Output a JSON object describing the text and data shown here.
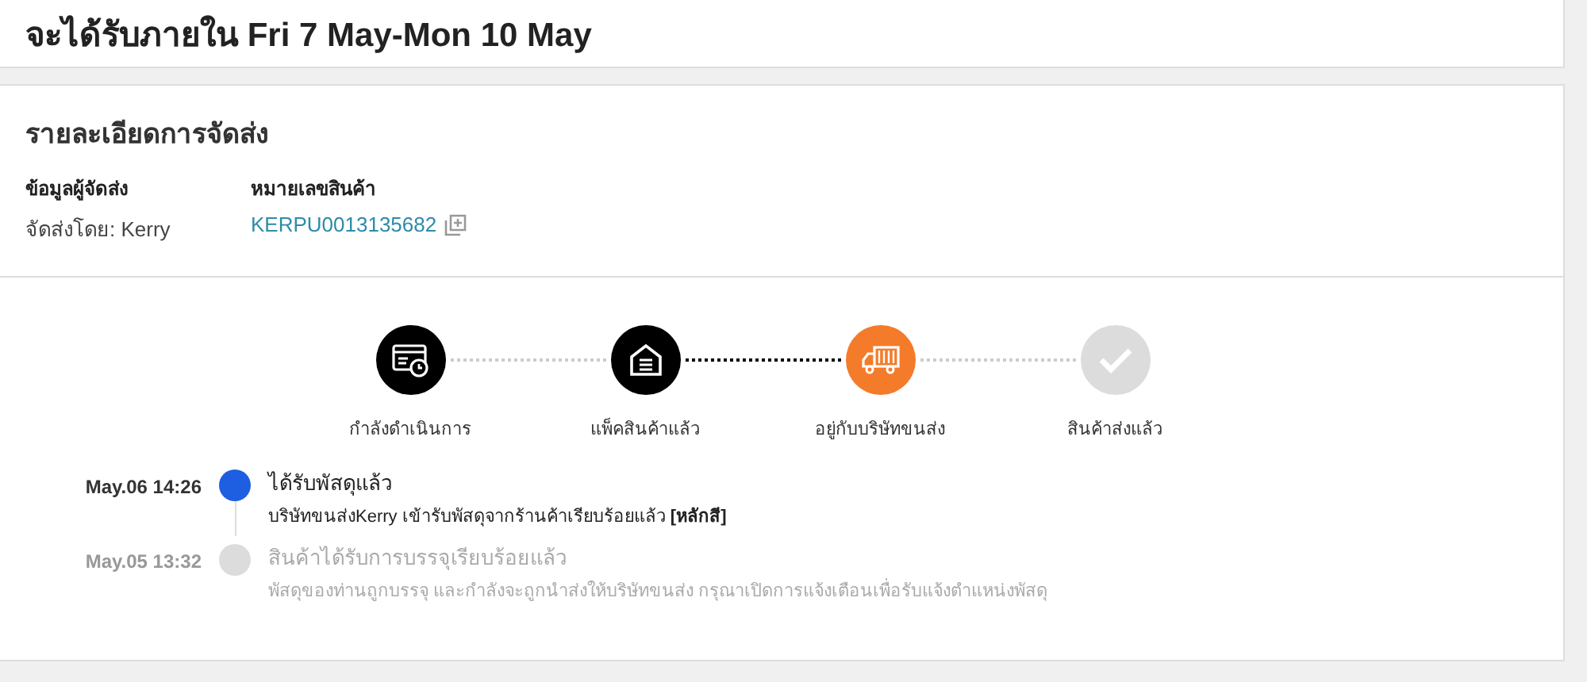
{
  "delivery_estimate": {
    "title": "จะได้รับภายใน Fri 7 May-Mon 10 May"
  },
  "shipping_details": {
    "title": "รายละเอียดการจัดส่ง",
    "carrier_label": "ข้อมูลผู้จัดส่ง",
    "carrier_value": "จัดส่งโดย: Kerry",
    "tracking_label": "หมายเลขสินค้า",
    "tracking_number": "KERPU0013135682"
  },
  "progress": {
    "steps": [
      {
        "kind": "processing",
        "reached": true,
        "current": false,
        "label": "กำลังดำเนินการ"
      },
      {
        "kind": "packed",
        "reached": true,
        "current": false,
        "label": "แพ็คสินค้าแล้ว"
      },
      {
        "kind": "shipping",
        "reached": true,
        "current": true,
        "label": "อยู่กับบริษัทขนส่ง"
      },
      {
        "kind": "delivered",
        "reached": false,
        "current": false,
        "label": "สินค้าส่งแล้ว"
      }
    ],
    "connectors": [
      {
        "active": false
      },
      {
        "active": true
      },
      {
        "active": false
      }
    ]
  },
  "timeline": [
    {
      "time": "May.06 14:26",
      "title": "ได้รับพัสดุแล้ว",
      "detail": "บริษัทขนส่งKerry เข้ารับพัสดุจากร้านค้าเรียบร้อยแล้ว **[หลักสี]**",
      "active": true
    },
    {
      "time": "May.05 13:32",
      "title": "สินค้าได้รับการบรรจุเรียบร้อยแล้ว",
      "detail": "พัสดุของท่านถูกบรรจุ และกำลังจะถูกนำส่งให้บริษัทขนส่ง กรุณาเปิดการแจ้งเตือนเพื่อรับแจ้งตำแหน่งพัสดุ",
      "active": false
    }
  ]
}
